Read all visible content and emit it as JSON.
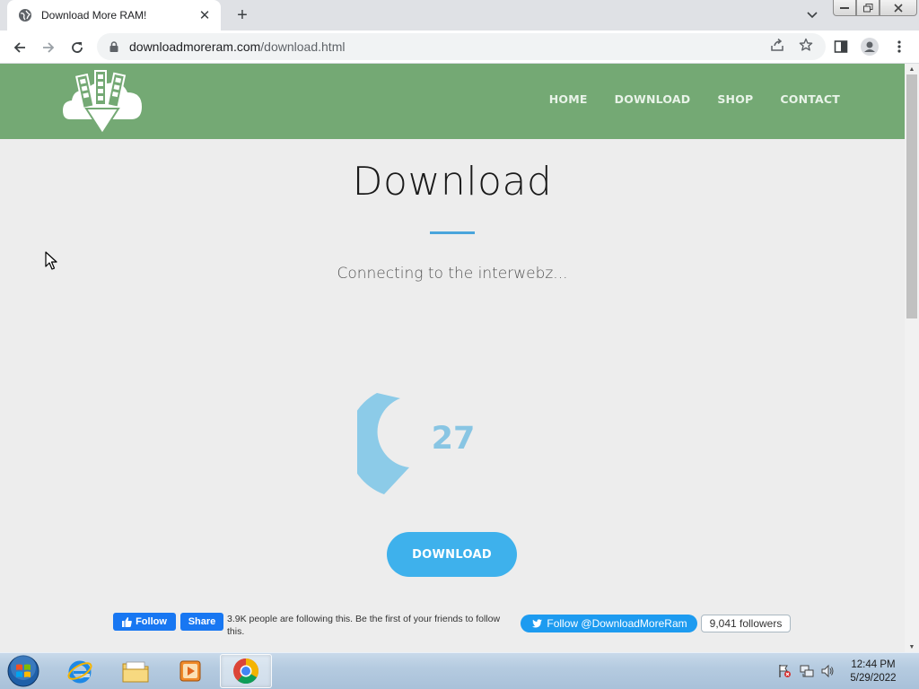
{
  "browser": {
    "tab_title": "Download More RAM!",
    "url_host": "downloadmoreram.com",
    "url_path": "/download.html"
  },
  "site": {
    "nav": [
      "HOME",
      "DOWNLOAD",
      "SHOP",
      "CONTACT"
    ],
    "heading": "Download",
    "status": "Connecting to the interwebz...",
    "progress_value": "27",
    "download_button": "DOWNLOAD",
    "accent_color": "#3eb1ec",
    "header_color": "#74a974"
  },
  "social": {
    "fb_follow": "Follow",
    "fb_share": "Share",
    "fb_text": "3.9K people are following this. Be the first of your friends to follow this.",
    "tw_follow": "Follow @DownloadMoreRam",
    "tw_followers": "9,041 followers"
  },
  "taskbar": {
    "time": "12:44 PM",
    "date": "5/29/2022"
  }
}
